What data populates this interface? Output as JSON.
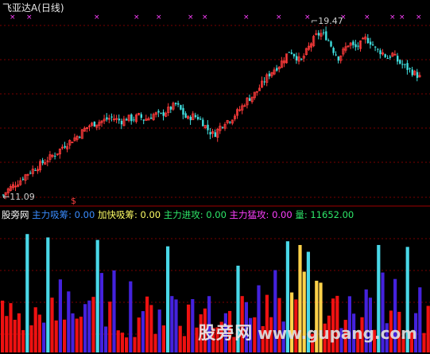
{
  "title": {
    "stock_name": "飞亚达A",
    "period": "(日线)"
  },
  "price_panel": {
    "high_label": "19.47",
    "low_label": "11.09",
    "arrow": "←",
    "signal_marker": "$",
    "colors": {
      "up": "#ff3b3b",
      "down": "#40e0e0",
      "marker": "#ff40ff",
      "grid": "#7a0000"
    }
  },
  "indicator_legend": {
    "items": [
      {
        "label": "股旁网",
        "color": "#ffffff"
      },
      {
        "label": "主力吸筹: 0.00",
        "color": "#3a8cff"
      },
      {
        "label": "加快吸筹: 0.00",
        "color": "#ffff66"
      },
      {
        "label": "主力进攻: 0.00",
        "color": "#2ee86a"
      },
      {
        "label": "主力猛攻: 0.00",
        "color": "#ff40ff"
      },
      {
        "label": "量: 11652.00",
        "color": "#2ee86a"
      }
    ]
  },
  "watermark": {
    "text": "股旁网",
    "url": "www.gupang.com"
  },
  "chart_data": [
    {
      "type": "candlestick",
      "title": "飞亚达A (日线)",
      "annotations": [
        "19.47",
        "11.09"
      ],
      "low": 11.09,
      "high": 19.47,
      "ylim": [
        10.8,
        20.3
      ],
      "close_path": [
        11.09,
        11.4,
        11.6,
        11.8,
        12.1,
        12.3,
        12.5,
        12.7,
        12.9,
        13.1,
        13.3,
        13.6,
        13.8,
        14.0,
        14.2,
        14.5,
        14.7,
        14.8,
        14.9,
        15.0,
        15.1,
        15.0,
        14.9,
        15.1,
        15.0,
        15.2,
        15.0,
        15.1,
        15.3,
        15.2,
        15.4,
        15.6,
        15.8,
        15.4,
        15.0,
        15.2,
        15.1,
        14.8,
        14.4,
        14.2,
        14.6,
        14.9,
        15.0,
        15.3,
        15.6,
        16.0,
        16.2,
        16.5,
        16.9,
        17.3,
        17.6,
        17.8,
        18.2,
        18.6,
        18.3,
        18.0,
        18.5,
        19.0,
        19.4,
        19.47,
        19.2,
        18.6,
        18.2,
        18.6,
        19.0,
        18.7,
        18.9,
        19.2,
        19.0,
        18.6,
        18.5,
        18.2,
        18.4,
        18.0,
        17.8,
        17.6,
        17.4,
        17.2
      ]
    },
    {
      "type": "bar",
      "series": [
        {
          "name": "主力吸筹",
          "values": [
            0,
            0,
            0,
            0,
            1,
            0,
            0,
            1,
            0,
            0,
            1,
            0,
            1,
            0,
            0,
            1,
            0,
            0,
            1,
            0,
            1,
            0,
            0,
            1,
            0,
            1,
            0,
            0,
            1,
            0,
            1,
            1,
            0,
            0,
            1,
            0,
            0,
            1,
            0,
            0,
            1,
            0,
            0,
            0,
            1,
            0,
            1,
            0,
            0,
            1,
            0,
            1,
            0,
            0,
            1,
            0,
            0,
            1,
            0,
            0,
            0,
            1,
            0,
            1,
            0,
            0,
            1,
            0,
            0,
            1,
            0,
            1,
            0,
            0,
            0,
            1,
            0,
            0
          ]
        },
        {
          "name": "加快吸筹",
          "values": [
            0,
            0,
            0,
            0,
            0,
            0,
            0,
            0,
            0,
            0,
            0,
            0,
            0,
            0,
            1,
            0,
            0,
            0,
            0,
            0,
            0,
            0,
            0,
            0,
            0,
            0,
            0,
            0,
            0,
            0,
            0,
            0,
            0,
            0,
            0,
            0,
            0,
            0,
            0,
            0,
            0,
            0,
            1,
            0,
            0,
            0,
            0,
            0,
            0,
            0,
            0,
            0,
            1,
            0,
            1,
            0,
            1,
            1,
            0,
            0,
            0,
            0,
            0,
            0,
            0,
            0,
            0,
            0,
            0,
            0,
            0,
            0,
            0,
            0,
            0,
            0,
            0,
            0
          ]
        }
      ]
    }
  ]
}
